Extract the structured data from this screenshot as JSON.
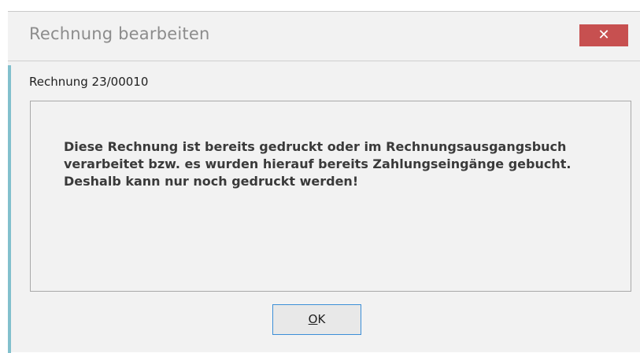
{
  "window": {
    "title": "Rechnung bearbeiten",
    "close_icon": "close-icon",
    "close_glyph": "✕"
  },
  "dialog": {
    "subtitle": "Rechnung 23/00010",
    "message": "Diese Rechnung ist bereits gedruckt oder im Rechnungsausgangsbuch verarbeitet bzw. es wurden hierauf bereits Zahlungseingänge gebucht. Deshalb kann nur noch gedruckt werden!",
    "ok_label": "OK",
    "ok_mnemonic": "O",
    "ok_rest": "K"
  },
  "colors": {
    "close_button": "#c75050",
    "accent_stripe": "#82c0cd",
    "focus_border": "#3c8fd8"
  }
}
